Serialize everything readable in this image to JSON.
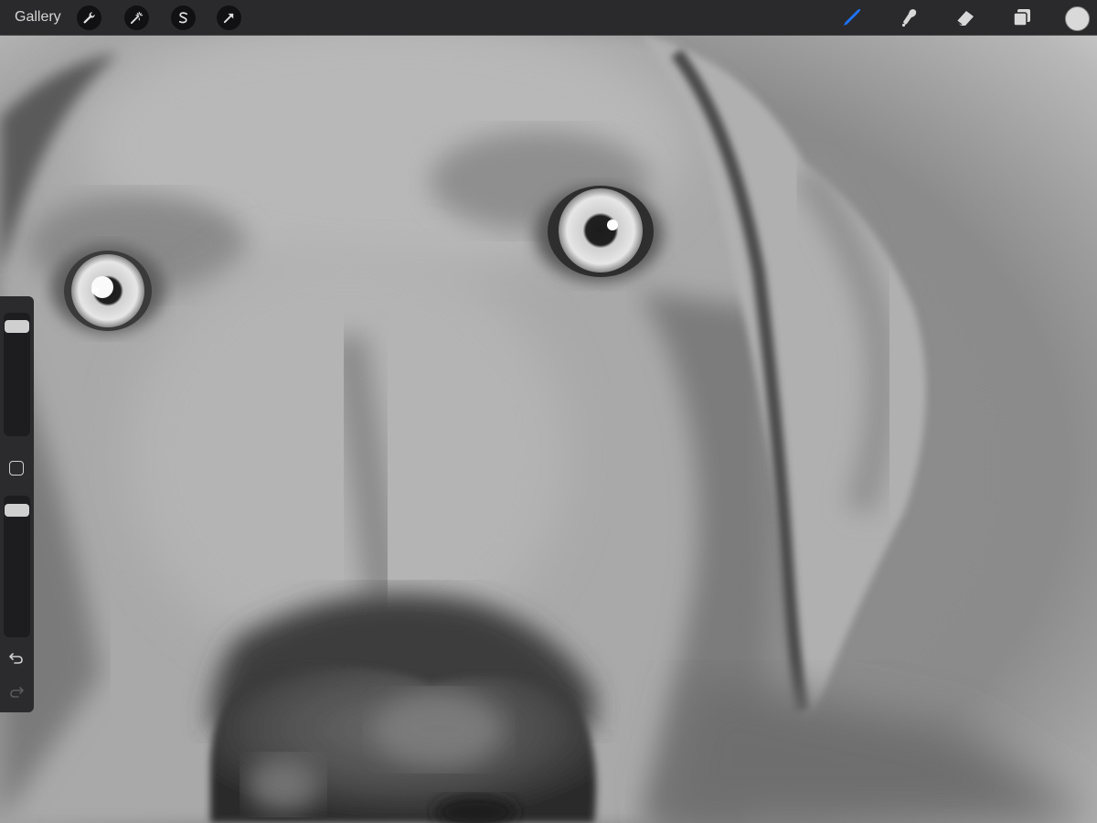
{
  "toolbar": {
    "gallery_label": "Gallery",
    "left_tools": [
      {
        "name": "actions-wrench-icon"
      },
      {
        "name": "adjustments-magic-wand-icon"
      },
      {
        "name": "selection-s-icon"
      },
      {
        "name": "transform-arrow-icon"
      }
    ],
    "right_tools": [
      {
        "name": "brush-icon",
        "active": true
      },
      {
        "name": "smudge-icon"
      },
      {
        "name": "eraser-icon"
      },
      {
        "name": "layers-icon"
      }
    ],
    "active_color": "#1e73ff",
    "current_color": "#d9d9d9"
  },
  "sidebar": {
    "size_level": 0.95,
    "opacity_level": 0.95
  }
}
